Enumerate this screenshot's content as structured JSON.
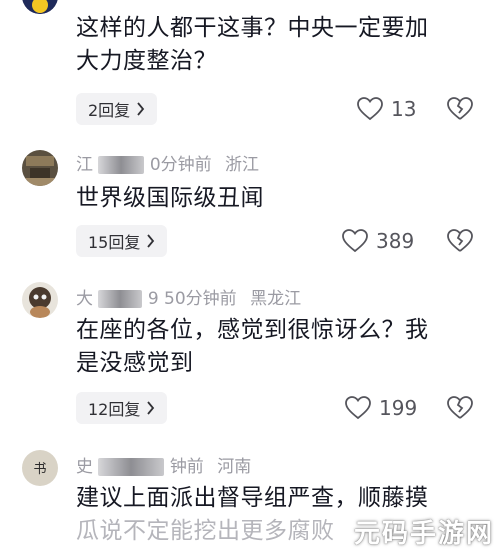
{
  "comments": [
    {
      "user": "",
      "time": "",
      "location": "",
      "lines": [
        "这样的人都干这事？中央一定要加",
        "大力度整治？"
      ],
      "replies": "2回复",
      "likes": "13"
    },
    {
      "user": "江",
      "time": "0分钟前",
      "location": "浙江",
      "lines": [
        "世界级国际级丑闻"
      ],
      "replies": "15回复",
      "likes": "389"
    },
    {
      "user": "大",
      "time": "9 50分钟前",
      "location": "黑龙江",
      "lines": [
        "在座的各位，感觉到很惊讶么？我",
        "是没感觉到"
      ],
      "replies": "12回复",
      "likes": "199"
    },
    {
      "user": "史",
      "time": "钟前",
      "location": "河南",
      "lines": [
        "建议上面派出督导组严查，顺藤摸",
        "瓜说不定能挖出更多腐败"
      ],
      "replies": "",
      "likes": ""
    }
  ],
  "watermark": "元码手游网",
  "icons": {
    "reply_chevron": "chevron-right-icon",
    "like": "heart-icon",
    "dislike": "broken-heart-icon"
  }
}
